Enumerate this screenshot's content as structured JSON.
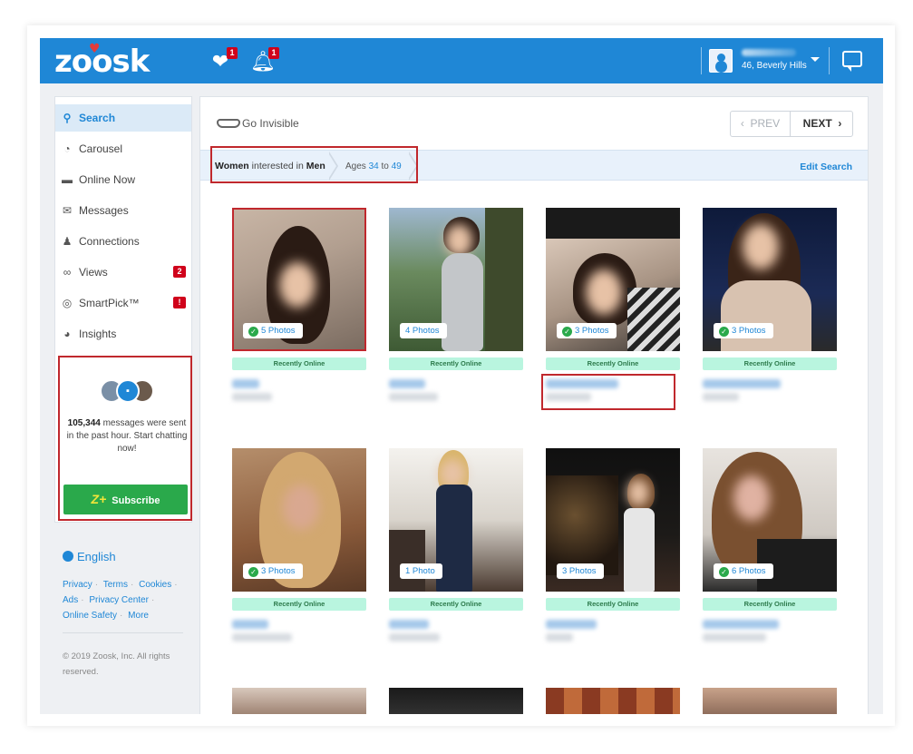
{
  "brand": {
    "logo_text": "zoosk",
    "accent": "#1f87d6"
  },
  "topbar": {
    "notifications": [
      {
        "icon": "heart-check-icon",
        "count": "1"
      },
      {
        "icon": "bell-icon",
        "count": "1"
      }
    ],
    "user_location": "46, Beverly Hills",
    "chat_icon": "chat-bubble-icon"
  },
  "sidebar": {
    "items": [
      {
        "label": "Search",
        "icon": "search-icon",
        "active": true
      },
      {
        "label": "Carousel",
        "icon": "carousel-icon"
      },
      {
        "label": "Online Now",
        "icon": "online-now-icon"
      },
      {
        "label": "Messages",
        "icon": "envelope-icon"
      },
      {
        "label": "Connections",
        "icon": "connections-icon"
      },
      {
        "label": "Views",
        "icon": "glasses-icon",
        "badge": "2"
      },
      {
        "label": "SmartPick™",
        "icon": "smartpick-icon",
        "badge": "!"
      },
      {
        "label": "Insights",
        "icon": "insights-icon"
      }
    ],
    "promo": {
      "count": "105,344",
      "text": " messages were sent in the past hour. Start chatting now!",
      "subscribe_label": "Subscribe"
    },
    "language": "English",
    "footer_links": [
      "Privacy",
      "Terms",
      "Cookies",
      "Ads",
      "Privacy Center",
      "Online Safety",
      "More"
    ],
    "copyright": "© 2019 Zoosk, Inc. All rights reserved."
  },
  "main": {
    "go_invisible": "Go Invisible",
    "pager": {
      "prev": "PREV",
      "next": "NEXT"
    },
    "crumbs": {
      "women": "Women",
      "interested_in": " interested in ",
      "men": "Men",
      "ages": "Ages ",
      "age_min": "34",
      "to": " to ",
      "age_max": "49"
    },
    "edit_search": "Edit Search",
    "recently_online": "Recently Online",
    "cards": [
      {
        "photos": "5 Photos",
        "check": true
      },
      {
        "photos": "4 Photos",
        "check": false
      },
      {
        "photos": "3 Photos",
        "check": true
      },
      {
        "photos": "3 Photos",
        "check": true
      },
      {
        "photos": "3 Photos",
        "check": true
      },
      {
        "photos": "1 Photo",
        "check": false
      },
      {
        "photos": "3 Photos",
        "check": false
      },
      {
        "photos": "6 Photos",
        "check": true
      }
    ]
  }
}
